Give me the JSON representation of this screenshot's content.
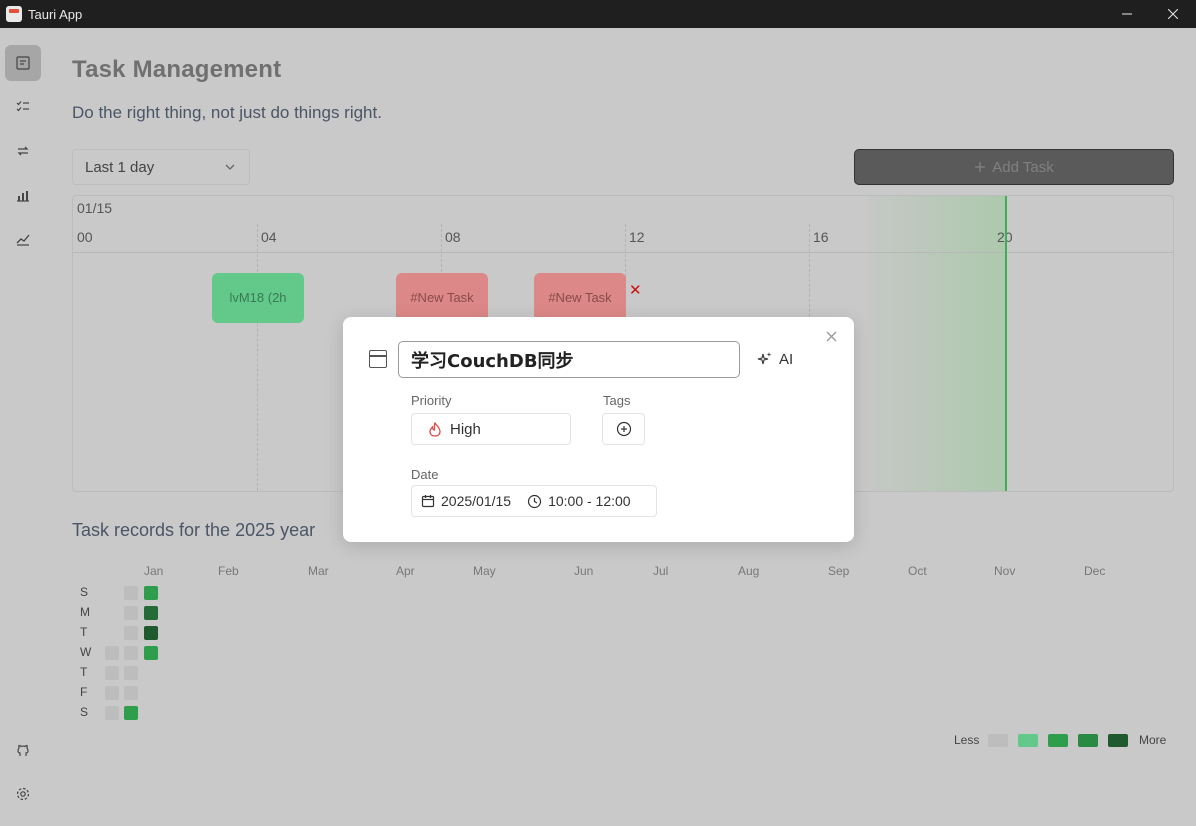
{
  "window": {
    "title": "Tauri App",
    "minimize_icon": "minimize-icon",
    "close_icon": "close-icon"
  },
  "sidebar": {
    "items": [
      {
        "name": "dashboard",
        "icon": "calendar-board-icon",
        "active": true
      },
      {
        "name": "tasks",
        "icon": "task-list-icon"
      },
      {
        "name": "sync",
        "icon": "repeat-icon"
      },
      {
        "name": "stats",
        "icon": "bar-chart-icon"
      },
      {
        "name": "trend",
        "icon": "line-chart-icon"
      }
    ],
    "bottom": [
      {
        "name": "github",
        "icon": "github-icon"
      },
      {
        "name": "settings",
        "icon": "settings-icon"
      }
    ]
  },
  "header": {
    "title": "Task Management",
    "subtitle": "Do the right thing, not just do things right."
  },
  "controls": {
    "range_value": "Last 1 day",
    "add_task_label": "Add Task",
    "add_task_icon": "plus-icon"
  },
  "timeline": {
    "date": "01/15",
    "hours": [
      "00",
      "04",
      "08",
      "12",
      "16",
      "20"
    ],
    "tasks": [
      {
        "label": "lvM18 (2h",
        "status": "green"
      },
      {
        "label": "#New Task",
        "status": "red"
      },
      {
        "label": "#New Task",
        "status": "red"
      }
    ]
  },
  "records": {
    "title": "Task records for the 2025 year",
    "months": [
      "Jan",
      "Feb",
      "Mar",
      "Apr",
      "May",
      "Jun",
      "Jul",
      "Aug",
      "Sep",
      "Oct",
      "Nov",
      "Dec"
    ],
    "days": [
      "S",
      "M",
      "T",
      "W",
      "T",
      "F",
      "S"
    ],
    "legend": {
      "less": "Less",
      "more": "More"
    },
    "colors": {
      "empty": "#bdbdbd",
      "l1": "#2f9e4c",
      "l2": "#2a8a43",
      "l3": "#246b37",
      "l4": "#1f5a2e"
    }
  },
  "modal": {
    "title_value": "学习CouchDB同步",
    "ai_label": "AI",
    "priority_label": "Priority",
    "priority_value": "High",
    "tags_label": "Tags",
    "date_label": "Date",
    "date_value": "2025/01/15",
    "time_value": "10:00 - 12:00"
  }
}
